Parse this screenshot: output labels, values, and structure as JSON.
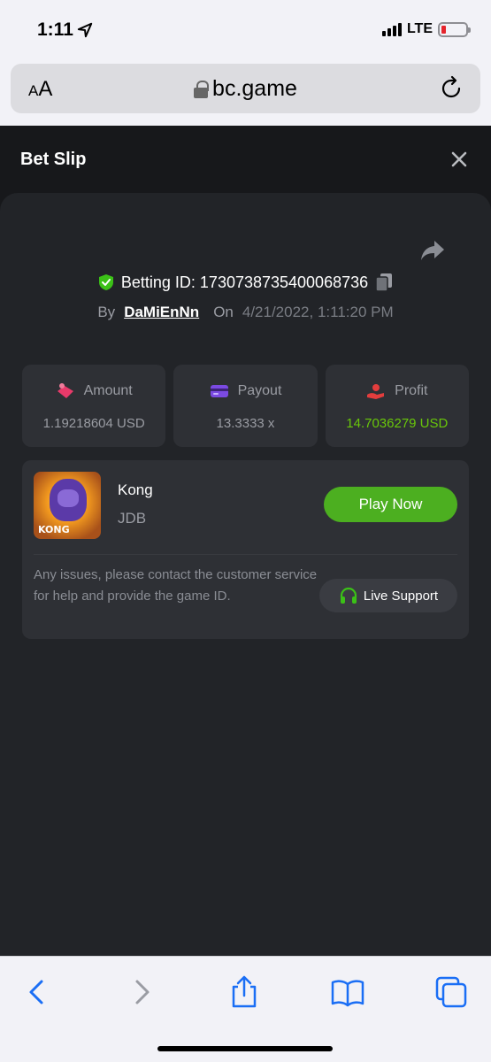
{
  "status": {
    "time": "1:11",
    "network": "LTE"
  },
  "browser": {
    "text_size_label": "AA",
    "url": "bc.game"
  },
  "modal": {
    "title": "Bet Slip",
    "betting_id_label": "Betting ID: 1730738735400068736",
    "by_label": "By",
    "username": "DaMiEnNn",
    "on_label": "On",
    "date": "4/21/2022, 1:11:20 PM"
  },
  "stats": {
    "amount": {
      "label": "Amount",
      "value": "1.19218604 USD"
    },
    "payout": {
      "label": "Payout",
      "value": "13.3333 x"
    },
    "profit": {
      "label": "Profit",
      "value": "14.7036279 USD"
    }
  },
  "game": {
    "name": "Kong",
    "provider": "JDB",
    "thumb_text": "KONG",
    "play_label": "Play Now",
    "issues_text": "Any issues, please contact the customer service for help and provide the game ID.",
    "support_label": "Live Support"
  },
  "colors": {
    "accent_green": "#4caf20",
    "profit_green": "#69c70a",
    "shield_green": "#3bc117"
  }
}
